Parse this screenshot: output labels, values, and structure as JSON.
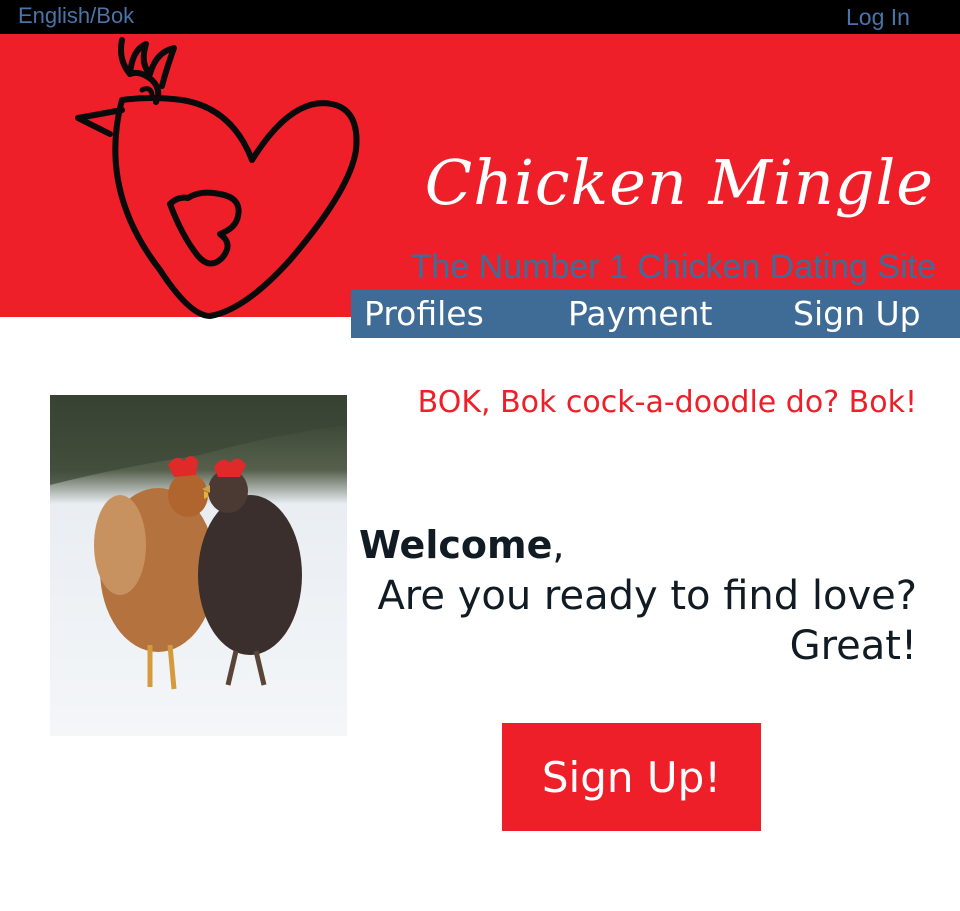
{
  "topbar": {
    "language_link": "English/Bok",
    "login_link": "Log In"
  },
  "header": {
    "site_title": "Chicken Mingle",
    "tagline": "The Number 1 Chicken Dating Site",
    "logo_icon": "heart-chicken-logo-icon"
  },
  "nav": {
    "items": [
      {
        "label": "Profiles"
      },
      {
        "label": "Payment"
      },
      {
        "label": "Sign Up"
      }
    ]
  },
  "main": {
    "photo": "two-chickens-in-snow",
    "bok_line": "BOK, Bok cock-a-doodle do? Bok!",
    "welcome_bold": "Welcome",
    "welcome_comma": ",",
    "ready_line": "Are you ready to find love?",
    "great_line": "Great!",
    "cta_label": "Sign Up!"
  },
  "colors": {
    "brand_red": "#ee1f28",
    "nav_blue": "#3f6c97",
    "link_blue": "#4a74a8",
    "text_dark": "#111b24"
  }
}
